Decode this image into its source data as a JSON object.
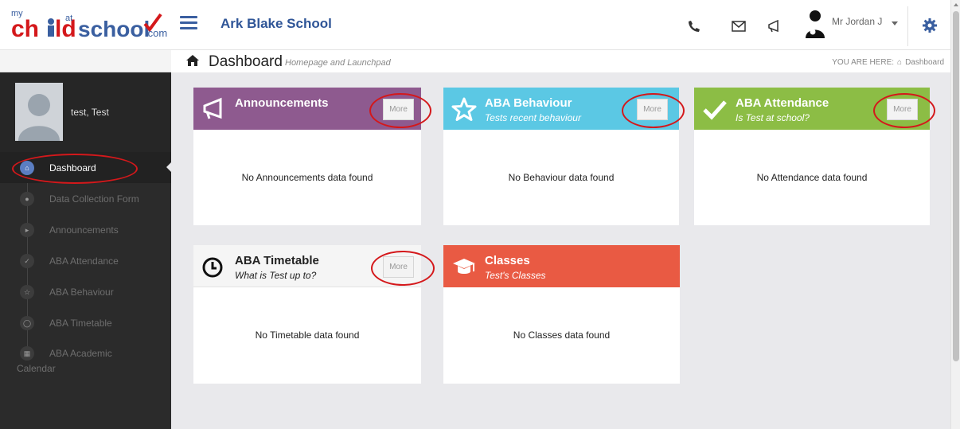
{
  "app": {
    "logo_text": "mychildatschool.com",
    "school_name": "Ark Blake School",
    "user_name": "Mr Jordan J"
  },
  "breadcrumb": {
    "title": "Dashboard",
    "subtitle": "Homepage and Launchpad",
    "you_are_here_label": "YOU ARE HERE:",
    "current": "Dashboard"
  },
  "sidebar": {
    "profile_name": "test, Test",
    "items": [
      {
        "label": "Dashboard",
        "icon": "home-icon",
        "active": true
      },
      {
        "label": "Data Collection Form",
        "icon": "user-icon"
      },
      {
        "label": "Announcements",
        "icon": "megaphone-icon"
      },
      {
        "label": "ABA Attendance",
        "icon": "check-icon"
      },
      {
        "label": "ABA Behaviour",
        "icon": "star-icon"
      },
      {
        "label": "ABA Timetable",
        "icon": "clock-icon"
      },
      {
        "label": "ABA Academic Calendar",
        "icon": "calendar-icon"
      }
    ]
  },
  "cards": {
    "announcements": {
      "title": "Announcements",
      "subtitle": "",
      "more": "More",
      "body": "No Announcements data found",
      "color": "#8e5a8f"
    },
    "behaviour": {
      "title": "ABA Behaviour",
      "subtitle": "Tests recent behaviour",
      "more": "More",
      "body": "No Behaviour data found",
      "color": "#5bc8e4"
    },
    "attendance": {
      "title": "ABA Attendance",
      "subtitle": "Is Test at school?",
      "more": "More",
      "body": "No Attendance data found",
      "color": "#8cbd45"
    },
    "timetable": {
      "title": "ABA Timetable",
      "subtitle": "What is Test up to?",
      "more": "More",
      "body": "No Timetable data found",
      "color": "#f5f5f5"
    },
    "classes": {
      "title": "Classes",
      "subtitle": "Test's Classes",
      "body": "No Classes data found",
      "color": "#e95a43"
    }
  },
  "colors": {
    "accent": "#2f5597",
    "sidebar_bg": "#2b2b2b",
    "highlight_ring": "#d4181b"
  }
}
